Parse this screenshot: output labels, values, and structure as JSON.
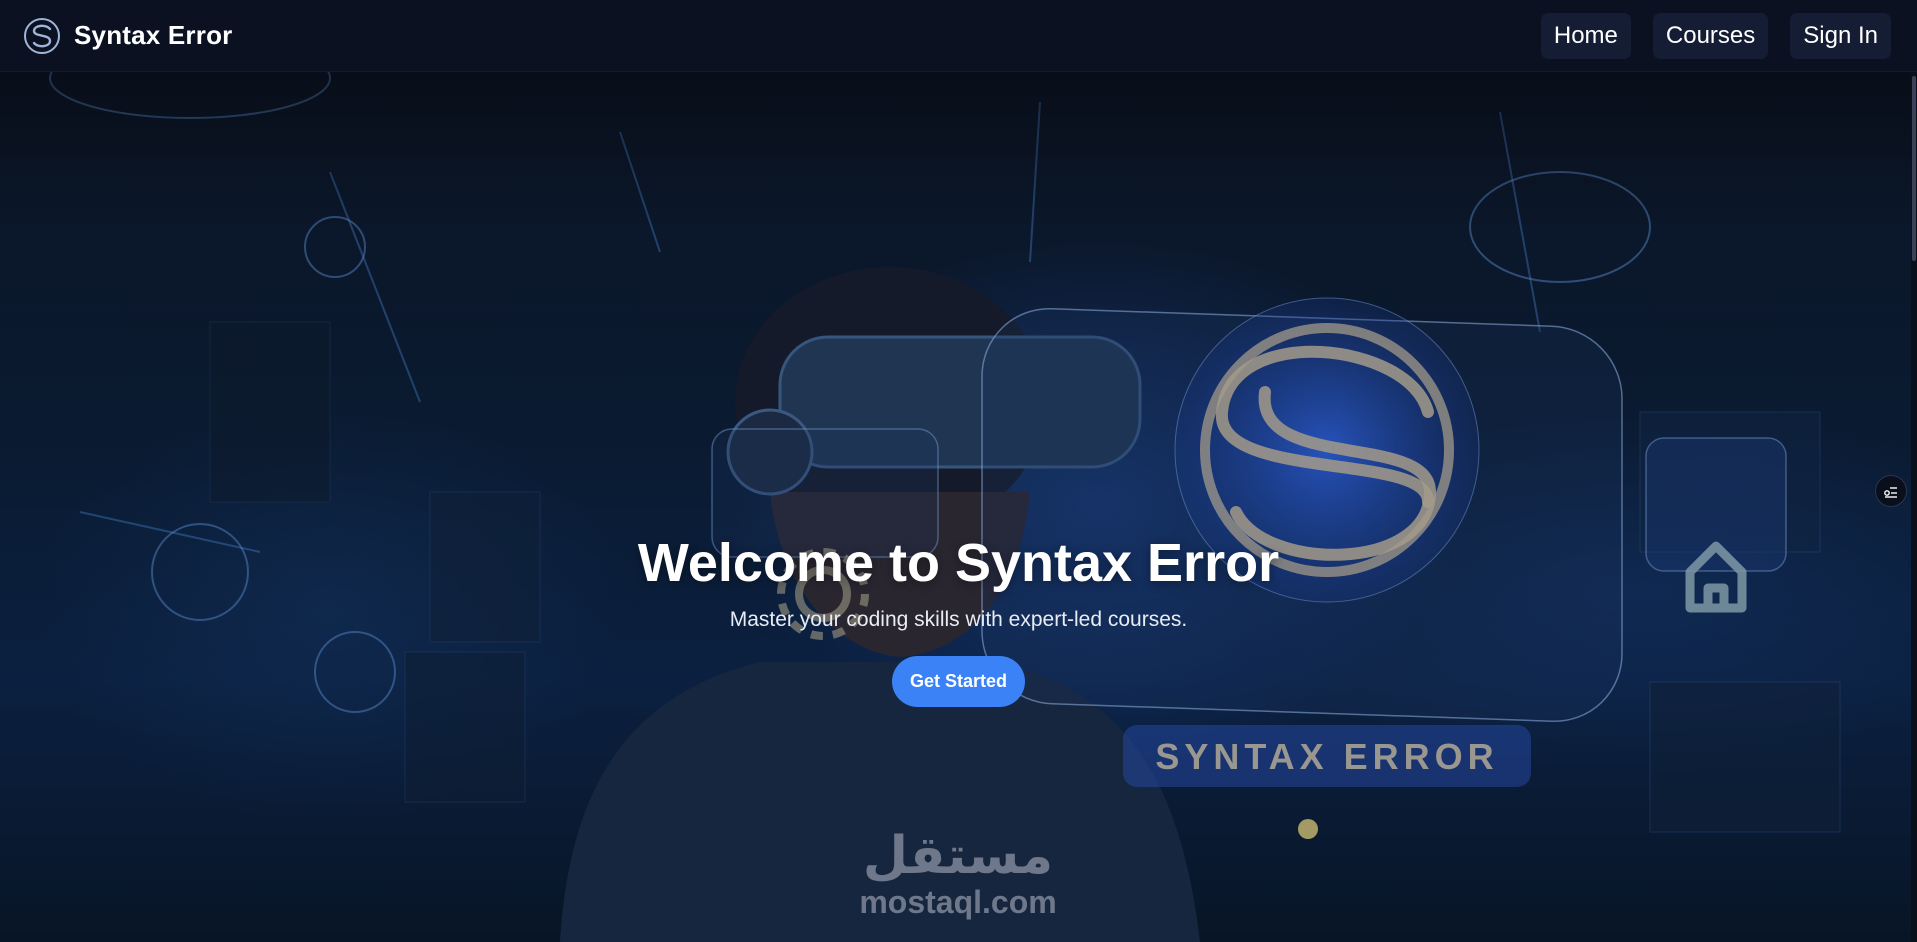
{
  "header": {
    "brand_name": "Syntax Error",
    "logo_icon": "syntax-error-s-logo",
    "nav": [
      {
        "label": "Home"
      },
      {
        "label": "Courses"
      },
      {
        "label": "Sign In"
      }
    ]
  },
  "hero": {
    "title": "Welcome to Syntax Error",
    "subtitle": "Master your coding skills with expert-led courses.",
    "cta_label": "Get Started",
    "panel_text": "SYNTAX ERROR",
    "panel_icons": [
      "gear-icon",
      "home-icon",
      "syntax-error-s-logo"
    ]
  },
  "watermark": {
    "arabic": "مستقل",
    "latin": "mostaql.com"
  },
  "side_widget_icon": "settings-list-icon",
  "colors": {
    "navbar_bg": "#0b1120",
    "nav_button_bg": "#141d33",
    "accent": "#3b82f6",
    "text": "#ffffff"
  }
}
